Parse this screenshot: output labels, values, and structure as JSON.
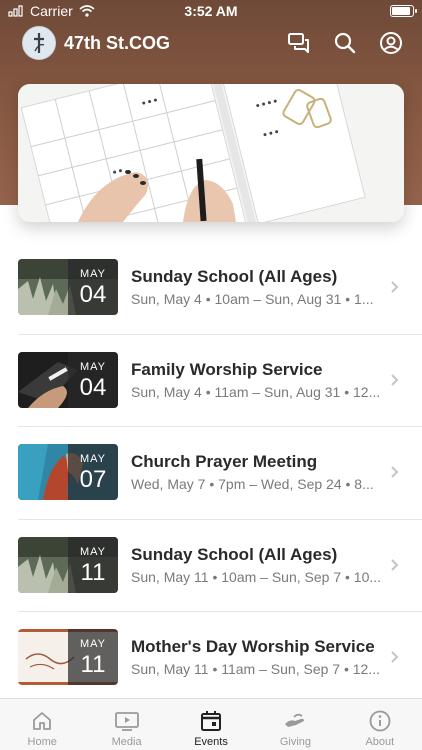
{
  "status": {
    "carrier": "Carrier",
    "time": "3:52 AM"
  },
  "header": {
    "title": "47th St.COG"
  },
  "events": [
    {
      "month": "MAY",
      "day": "04",
      "title": "Sunday School (All Ages)",
      "subtitle": "Sun, May 4 • 10am – Sun, Aug 31 • 1..."
    },
    {
      "month": "MAY",
      "day": "04",
      "title": "Family Worship Service",
      "subtitle": "Sun, May 4 • 11am – Sun, Aug 31 • 12..."
    },
    {
      "month": "MAY",
      "day": "07",
      "title": "Church Prayer Meeting",
      "subtitle": "Wed, May 7 • 7pm – Wed, Sep 24 • 8..."
    },
    {
      "month": "MAY",
      "day": "11",
      "title": "Sunday School (All Ages)",
      "subtitle": "Sun, May 11 • 10am – Sun, Sep 7 • 10..."
    },
    {
      "month": "MAY",
      "day": "11",
      "title": "Mother's Day Worship Service",
      "subtitle": "Sun, May 11 • 11am – Sun, Sep 7 • 12..."
    }
  ],
  "tabs": [
    {
      "label": "Home",
      "icon": "home-icon"
    },
    {
      "label": "Media",
      "icon": "media-icon"
    },
    {
      "label": "Events",
      "icon": "calendar-icon"
    },
    {
      "label": "Giving",
      "icon": "giving-icon"
    },
    {
      "label": "About",
      "icon": "info-icon"
    }
  ],
  "colors": {
    "header_brown": "#8a5b44",
    "active_tab": "#222222",
    "inactive_tab": "#9a9a9a"
  }
}
